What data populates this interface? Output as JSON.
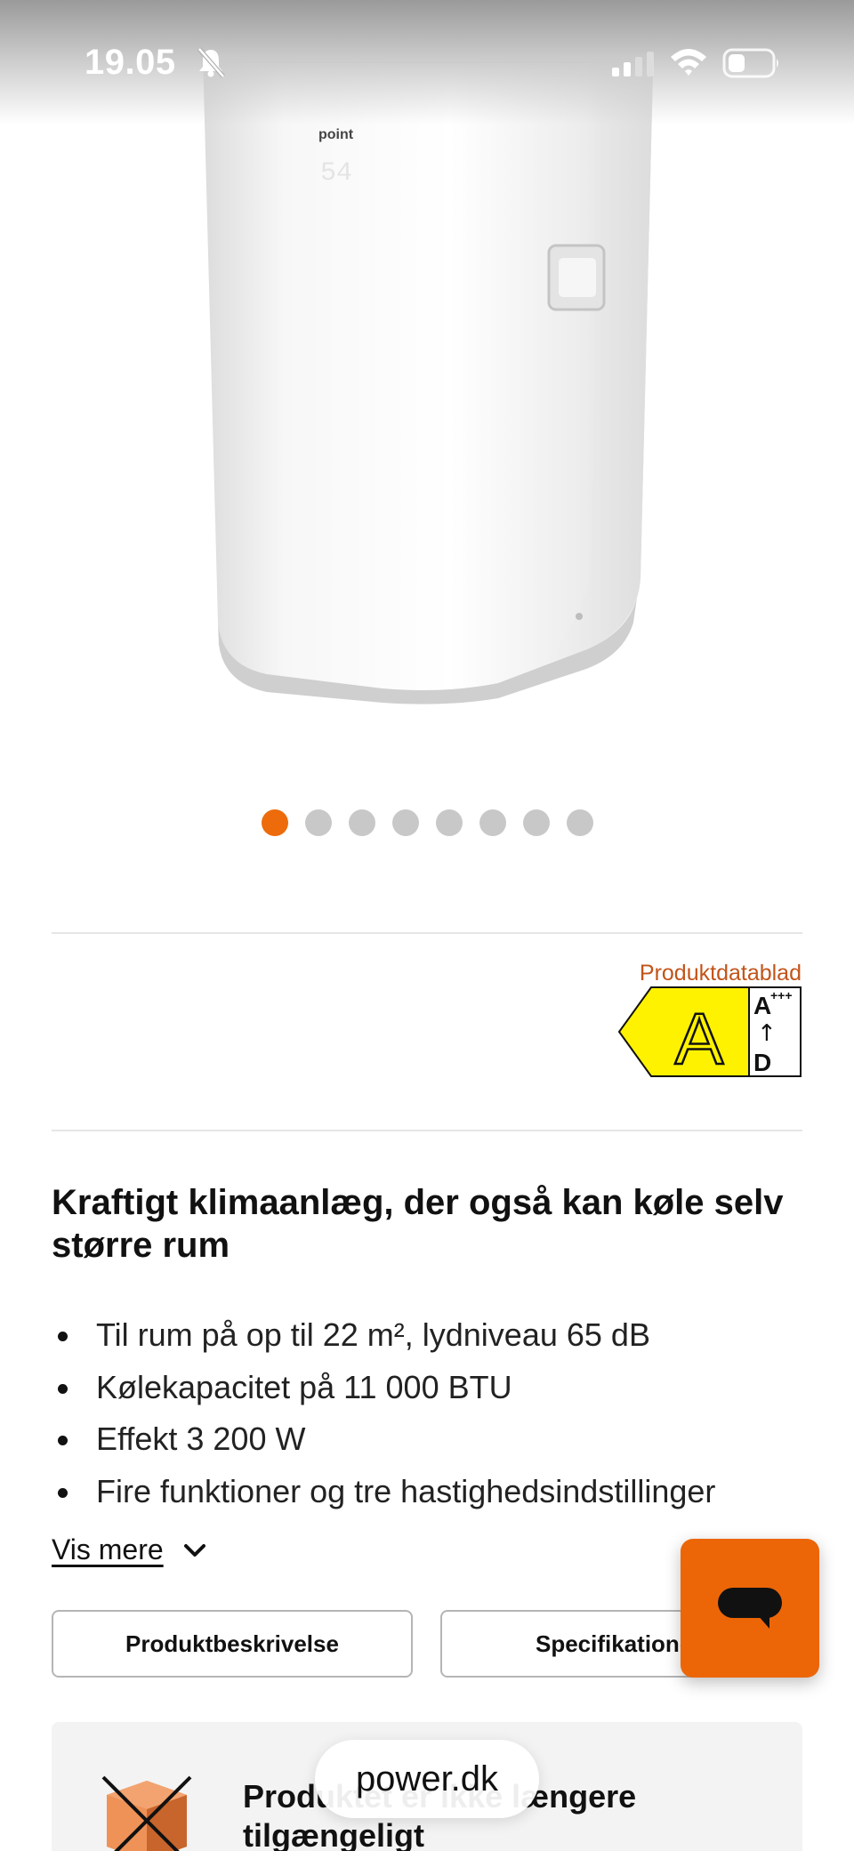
{
  "status_bar": {
    "time": "19.05"
  },
  "product": {
    "brand_on_device": "point",
    "display_reading": "54",
    "image_count": 8,
    "active_image_index": 0
  },
  "energy": {
    "datasheet_link": "Produktdatablad",
    "class": "A",
    "scale_top": "A",
    "scale_top_sup": "+++",
    "scale_arrow": "↑",
    "scale_bottom": "D",
    "color": "#ffff00"
  },
  "headline": "Kraftigt klimaanlæg, der også kan køle selv større rum",
  "bullets": [
    "Til rum på op til 22 m², lydniveau 65 dB",
    "Kølekapacitet på 11 000 BTU",
    "Effekt 3 200 W",
    "Fire funktioner og tre hastighedsindstillinger"
  ],
  "show_more": "Vis mere",
  "tabs": {
    "description": "Produktbeskrivelse",
    "specs": "Specifikationer"
  },
  "availability": {
    "text": "Produktet er ikke længere tilgængeligt"
  },
  "browser": {
    "url": "power.dk"
  },
  "colors": {
    "accent": "#ec6608",
    "datasheet": "#c2541a"
  }
}
